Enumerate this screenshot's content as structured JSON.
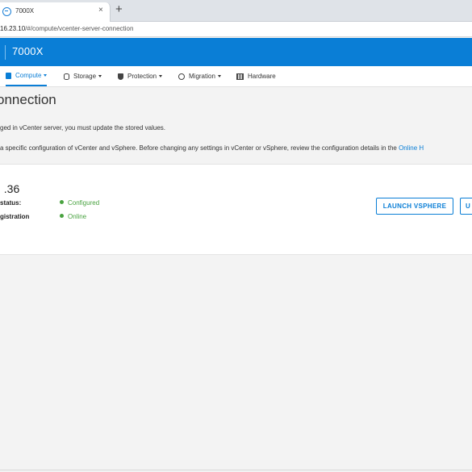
{
  "browser": {
    "tab_title": "7000X",
    "tab_close": "×",
    "new_tab": "+",
    "url_host": "16.23.10",
    "url_path": "/#/compute/vcenter-server-connection"
  },
  "header": {
    "title": "7000X"
  },
  "nav": {
    "items": [
      {
        "label": "Compute",
        "active": true,
        "icon": "compute-icon"
      },
      {
        "label": "Storage",
        "active": false,
        "icon": "database-icon"
      },
      {
        "label": "Protection",
        "active": false,
        "icon": "shield-icon"
      },
      {
        "label": "Migration",
        "active": false,
        "icon": "migration-icon"
      },
      {
        "label": "Hardware",
        "active": false,
        "icon": "hardware-icon"
      }
    ]
  },
  "page": {
    "title": "onnection",
    "message1": "ged in vCenter server, you must update the stored values.",
    "message2": "a specific configuration of vCenter and vSphere. Before changing any settings in vCenter or vSphere, review the configuration details in the",
    "message2_link": "Online H"
  },
  "server": {
    "ip": ".36",
    "status_label": "status:",
    "status_value": "Configured",
    "registration_label": "gistration",
    "registration_value": "Online"
  },
  "buttons": {
    "launch": "LAUNCH VSPHERE",
    "second": "U"
  },
  "colors": {
    "accent": "#0a7ed6",
    "status_ok": "#48a23f"
  }
}
